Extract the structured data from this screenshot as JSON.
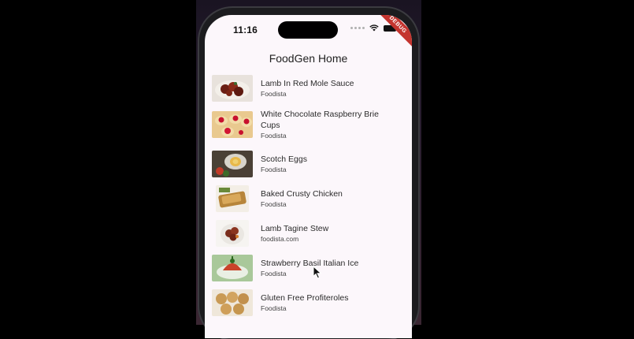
{
  "status_bar": {
    "time": "11:16"
  },
  "debug_banner": "DEBUG",
  "app": {
    "title": "FoodGen Home"
  },
  "recipes": [
    {
      "name": "Lamb In Red Mole Sauce",
      "source": "Foodista"
    },
    {
      "name": "White Chocolate Raspberry Brie Cups",
      "source": "Foodista"
    },
    {
      "name": "Scotch Eggs",
      "source": "Foodista"
    },
    {
      "name": "Baked Crusty Chicken",
      "source": "Foodista"
    },
    {
      "name": "Lamb Tagine Stew",
      "source": "foodista.com"
    },
    {
      "name": "Strawberry Basil Italian Ice",
      "source": "Foodista"
    },
    {
      "name": "Gluten Free Profiteroles",
      "source": "Foodista"
    }
  ]
}
